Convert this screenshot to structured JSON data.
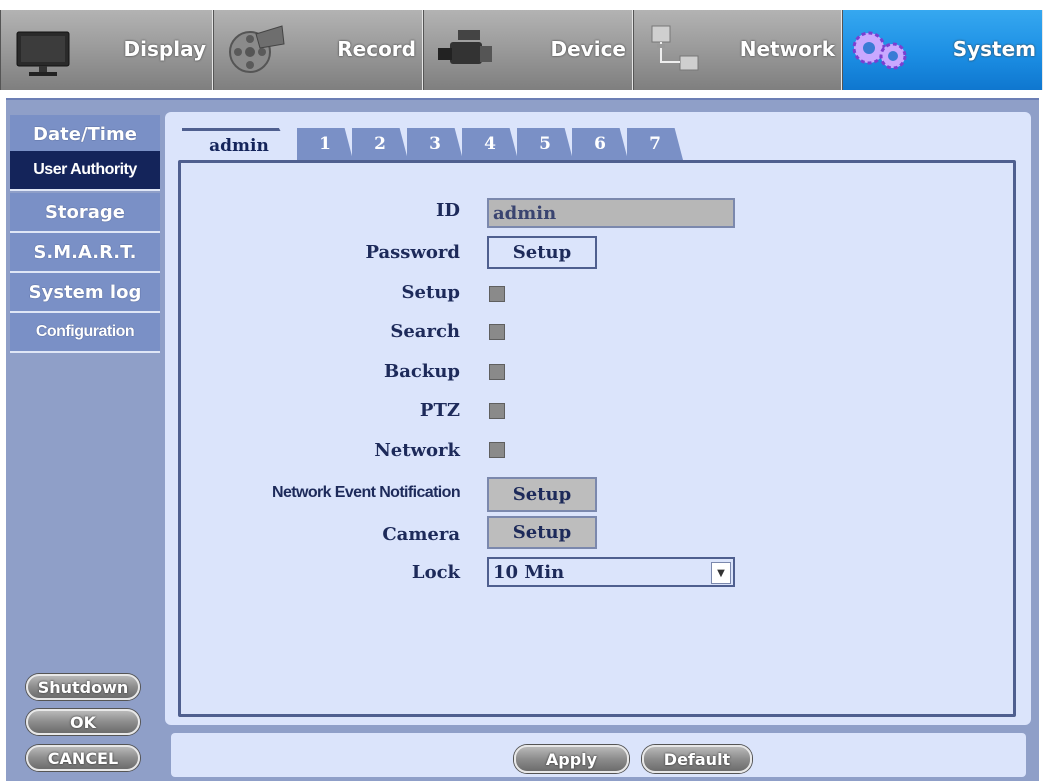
{
  "top_menu": [
    {
      "label": "Display",
      "icon": "monitor-icon"
    },
    {
      "label": "Record",
      "icon": "film-reel-icon"
    },
    {
      "label": "Device",
      "icon": "video-camera-icon"
    },
    {
      "label": "Network",
      "icon": "network-computers-icon"
    },
    {
      "label": "System",
      "icon": "gears-icon",
      "active": true
    }
  ],
  "sidebar": {
    "items": [
      {
        "label": "Date/Time"
      },
      {
        "label": "User Authority",
        "active": true
      },
      {
        "label": "Storage"
      },
      {
        "label": "S.M.A.R.T."
      },
      {
        "label": "System log"
      },
      {
        "label": "Configuration"
      }
    ],
    "shutdown": "Shutdown",
    "ok": "OK",
    "cancel": "CANCEL"
  },
  "tabs": [
    "admin",
    "1",
    "2",
    "3",
    "4",
    "5",
    "6",
    "7"
  ],
  "form": {
    "id_label": "ID",
    "id_value": "admin",
    "password_label": "Password",
    "password_button": "Setup",
    "setup_label": "Setup",
    "search_label": "Search",
    "backup_label": "Backup",
    "ptz_label": "PTZ",
    "network_label": "Network",
    "notification_label": "Network Event Notification",
    "notification_button": "Setup",
    "camera_label": "Camera",
    "camera_button": "Setup",
    "lock_label": "Lock",
    "lock_value": "10 Min"
  },
  "bottom": {
    "apply": "Apply",
    "default": "Default"
  },
  "colors": {
    "active_menu": "#1c8fe4",
    "sidebar": "#7a90c6",
    "panel": "#dbe4fb",
    "border": "#4f5f8f"
  }
}
